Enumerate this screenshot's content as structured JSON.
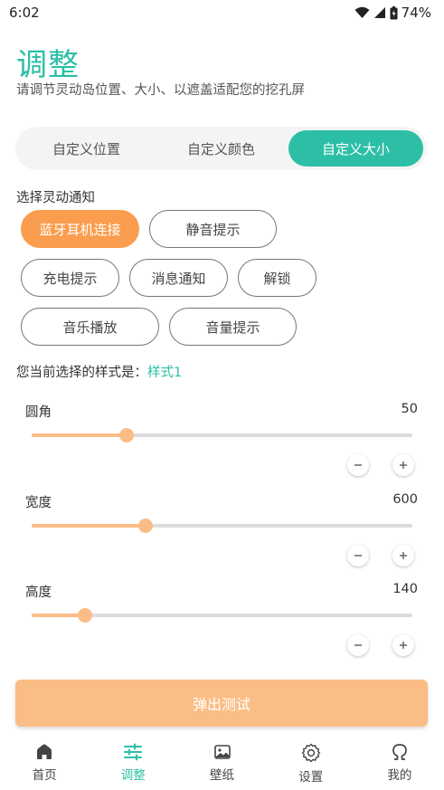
{
  "status_bar": {
    "time": "6:02",
    "battery": "74%",
    "icons": [
      "wifi-icon",
      "signal-icon",
      "battery-icon"
    ]
  },
  "header": {
    "title": "调整",
    "subtitle": "请调节灵动岛位置、大小、以遮盖适配您的挖孔屏"
  },
  "tabs": [
    {
      "label": "自定义位置",
      "active": false
    },
    {
      "label": "自定义颜色",
      "active": false
    },
    {
      "label": "自定义大小",
      "active": true
    }
  ],
  "notification_select": {
    "label": "选择灵动通知",
    "options": [
      {
        "label": "蓝牙耳机连接",
        "active": true
      },
      {
        "label": "静音提示",
        "active": false
      },
      {
        "label": "充电提示",
        "active": false
      },
      {
        "label": "消息通知",
        "active": false
      },
      {
        "label": "解锁",
        "active": false
      },
      {
        "label": "音乐播放",
        "active": false
      },
      {
        "label": "音量提示",
        "active": false
      }
    ]
  },
  "current_style": {
    "prefix": "您当前选择的样式是：",
    "value": "样式1"
  },
  "sliders": [
    {
      "label": "圆角",
      "value": "50",
      "fraction": 0.25
    },
    {
      "label": "宽度",
      "value": "600",
      "fraction": 0.3
    },
    {
      "label": "高度",
      "value": "140",
      "fraction": 0.14
    }
  ],
  "action": {
    "label": "弹出测试"
  },
  "bottom_nav": [
    {
      "label": "首页",
      "icon": "home-icon",
      "active": false
    },
    {
      "label": "调整",
      "icon": "sliders-icon",
      "active": true
    },
    {
      "label": "壁纸",
      "icon": "image-icon",
      "active": false
    },
    {
      "label": "设置",
      "icon": "gear-icon",
      "active": false
    },
    {
      "label": "我的",
      "icon": "user-icon",
      "active": false
    }
  ],
  "colors": {
    "accent": "#2cbfa6",
    "orange_active": "#fb9d4e",
    "orange_light": "#fbbd86"
  }
}
